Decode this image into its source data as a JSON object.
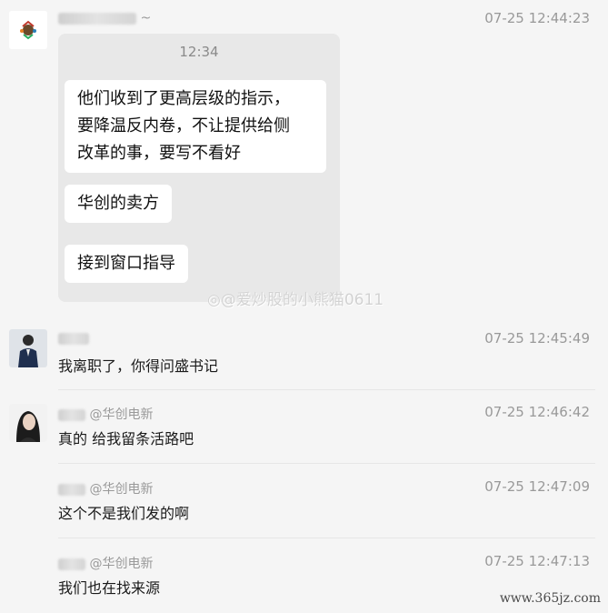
{
  "messages": [
    {
      "avatar": "brand-logo-avatar",
      "sender_suffix": "~",
      "time": "07-25 12:44:23",
      "screenshot": {
        "status_time": "12:34",
        "bubbles": [
          "他们收到了更高层级的指示，",
          "要降温反内卷，不让提供给侧",
          "改革的事，要写不看好",
          "华创的卖方",
          "接到窗口指导"
        ]
      }
    },
    {
      "avatar": "man-in-suit-avatar",
      "sender_suffix": "",
      "time": "07-25 12:45:49",
      "text": "我离职了，你得问盛书记"
    },
    {
      "avatar": "woman-portrait-avatar",
      "sender_suffix": "@华创电新",
      "time": "07-25 12:46:42",
      "text": "真的 给我留条活路吧"
    },
    {
      "sender_suffix": "@华创电新",
      "time": "07-25 12:47:09",
      "text": "这个不是我们发的啊"
    },
    {
      "sender_suffix": "@华创电新",
      "time": "07-25 12:47:13",
      "text": "我们也在找来源"
    }
  ],
  "watermark": "@爱炒股的小熊猫0611",
  "site_watermark": "www.365jz.com"
}
